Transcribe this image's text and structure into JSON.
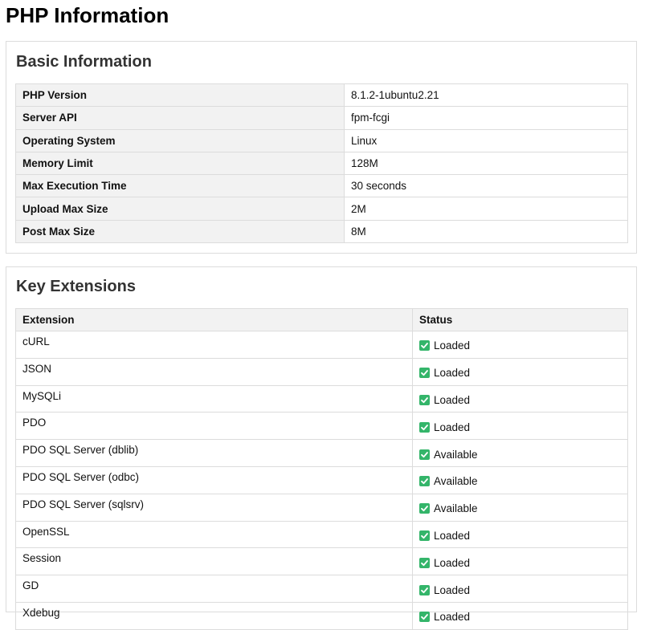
{
  "page": {
    "title": "PHP Information"
  },
  "basic": {
    "title": "Basic Information",
    "rows": [
      {
        "label": "PHP Version",
        "value": "8.1.2-1ubuntu2.21"
      },
      {
        "label": "Server API",
        "value": "fpm-fcgi"
      },
      {
        "label": "Operating System",
        "value": "Linux"
      },
      {
        "label": "Memory Limit",
        "value": "128M"
      },
      {
        "label": "Max Execution Time",
        "value": "30 seconds"
      },
      {
        "label": "Upload Max Size",
        "value": "2M"
      },
      {
        "label": "Post Max Size",
        "value": "8M"
      }
    ]
  },
  "extensions": {
    "title": "Key Extensions",
    "headers": {
      "extension": "Extension",
      "status": "Status"
    },
    "rows": [
      {
        "name": "cURL",
        "status": "Loaded"
      },
      {
        "name": "JSON",
        "status": "Loaded"
      },
      {
        "name": "MySQLi",
        "status": "Loaded"
      },
      {
        "name": "PDO",
        "status": "Loaded"
      },
      {
        "name": "PDO SQL Server (dblib)",
        "status": "Available"
      },
      {
        "name": "PDO SQL Server (odbc)",
        "status": "Available"
      },
      {
        "name": "PDO SQL Server (sqlsrv)",
        "status": "Available"
      },
      {
        "name": "OpenSSL",
        "status": "Loaded"
      },
      {
        "name": "Session",
        "status": "Loaded"
      },
      {
        "name": "GD",
        "status": "Loaded"
      },
      {
        "name": "Xdebug",
        "status": "Loaded"
      }
    ],
    "status_icon": "check-mark-icon",
    "status_icon_color": "#34b56a"
  }
}
